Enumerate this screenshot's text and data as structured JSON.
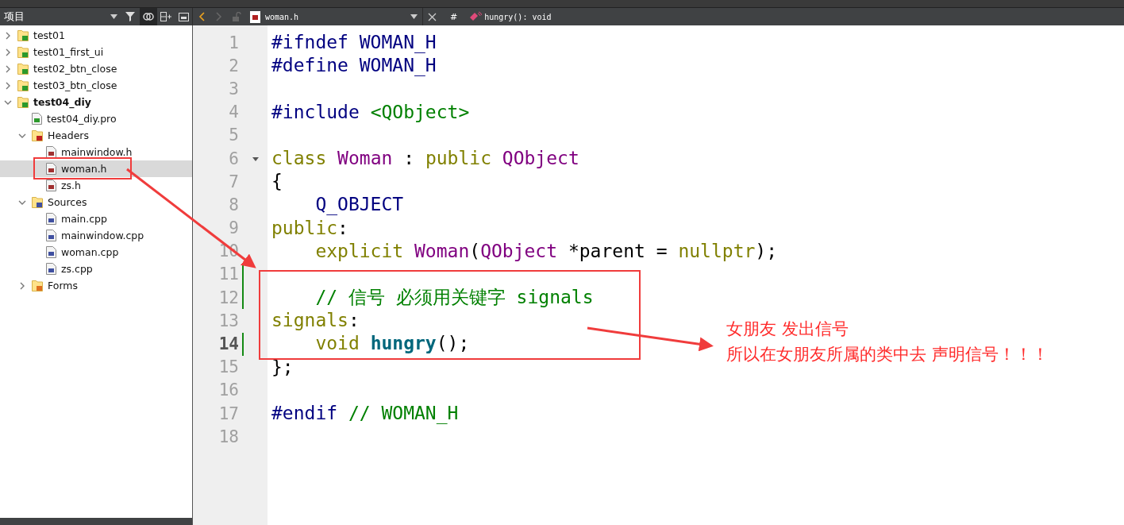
{
  "toolbar": {
    "panel_title": "项目",
    "file": "woman.h",
    "hash": "#",
    "symbol": "hungry(): void"
  },
  "tree": [
    {
      "label": "test01",
      "kind": "project",
      "active": false,
      "expanded": false,
      "selected": false
    },
    {
      "label": "test01_first_ui",
      "kind": "project",
      "active": false,
      "expanded": false,
      "selected": false
    },
    {
      "label": "test02_btn_close",
      "kind": "project",
      "active": false,
      "expanded": false,
      "selected": false
    },
    {
      "label": "test03_btn_close",
      "kind": "project",
      "active": false,
      "expanded": false,
      "selected": false
    },
    {
      "label": "test04_diy",
      "kind": "project",
      "active": true,
      "expanded": true,
      "selected": false,
      "children": [
        {
          "label": "test04_diy.pro",
          "kind": "pro",
          "selected": false
        },
        {
          "label": "Headers",
          "kind": "headers",
          "expanded": true,
          "selected": false,
          "children": [
            {
              "label": "mainwindow.h",
              "kind": "header",
              "selected": false
            },
            {
              "label": "woman.h",
              "kind": "header",
              "selected": true
            },
            {
              "label": "zs.h",
              "kind": "header",
              "selected": false
            }
          ]
        },
        {
          "label": "Sources",
          "kind": "sources",
          "expanded": true,
          "selected": false,
          "children": [
            {
              "label": "main.cpp",
              "kind": "source",
              "selected": false
            },
            {
              "label": "mainwindow.cpp",
              "kind": "source",
              "selected": false
            },
            {
              "label": "woman.cpp",
              "kind": "source",
              "selected": false
            },
            {
              "label": "zs.cpp",
              "kind": "source",
              "selected": false
            }
          ]
        },
        {
          "label": "Forms",
          "kind": "forms",
          "expanded": false,
          "selected": false
        }
      ]
    }
  ],
  "code": [
    {
      "number": "1",
      "current": false,
      "changed": false,
      "fold": false,
      "tokens": [
        {
          "text": "#ifndef WOMAN_H",
          "kind": "preprocessor"
        }
      ]
    },
    {
      "number": "2",
      "current": false,
      "changed": false,
      "fold": false,
      "tokens": [
        {
          "text": "#define WOMAN_H",
          "kind": "preprocessor"
        }
      ]
    },
    {
      "number": "3",
      "current": false,
      "changed": false,
      "fold": false
    },
    {
      "number": "4",
      "current": false,
      "changed": false,
      "fold": false,
      "tokens": [
        {
          "text": "#include ",
          "kind": "preprocessor"
        },
        {
          "text": "<QObject>",
          "kind": "string"
        }
      ]
    },
    {
      "number": "5",
      "current": false,
      "changed": false,
      "fold": false
    },
    {
      "number": "6",
      "current": false,
      "changed": false,
      "fold": true,
      "tokens": [
        {
          "text": "class ",
          "kind": "keyword"
        },
        {
          "text": "Woman",
          "kind": "type"
        },
        {
          "text": " : ",
          "kind": "plain"
        },
        {
          "text": "public ",
          "kind": "keyword"
        },
        {
          "text": "QObject",
          "kind": "type"
        }
      ]
    },
    {
      "number": "7",
      "current": false,
      "changed": false,
      "fold": false,
      "tokens": [
        {
          "text": "{",
          "kind": "plain"
        }
      ]
    },
    {
      "number": "8",
      "current": false,
      "changed": false,
      "fold": false,
      "tokens": [
        {
          "text": "    Q_OBJECT",
          "kind": "preprocessor"
        }
      ]
    },
    {
      "number": "9",
      "current": false,
      "changed": false,
      "fold": false,
      "tokens": [
        {
          "text": "public",
          "kind": "keyword"
        },
        {
          "text": ":",
          "kind": "plain"
        }
      ]
    },
    {
      "number": "10",
      "current": false,
      "changed": false,
      "fold": false,
      "tokens": [
        {
          "text": "    explicit ",
          "kind": "keyword"
        },
        {
          "text": "Woman",
          "kind": "type"
        },
        {
          "text": "(",
          "kind": "plain"
        },
        {
          "text": "QObject",
          "kind": "type"
        },
        {
          "text": " *parent = ",
          "kind": "plain"
        },
        {
          "text": "nullptr",
          "kind": "keyword"
        },
        {
          "text": ");",
          "kind": "plain"
        }
      ]
    },
    {
      "number": "11",
      "current": false,
      "changed": true,
      "fold": false
    },
    {
      "number": "12",
      "current": false,
      "changed": true,
      "fold": false,
      "tokens": [
        {
          "text": "    // 信号 必须用关键字 signals",
          "kind": "comment"
        }
      ]
    },
    {
      "number": "13",
      "current": false,
      "changed": false,
      "fold": false,
      "tokens": [
        {
          "text": "signals",
          "kind": "keyword"
        },
        {
          "text": ":",
          "kind": "plain"
        }
      ]
    },
    {
      "number": "14",
      "current": true,
      "changed": true,
      "fold": false,
      "tokens": [
        {
          "text": "    void ",
          "kind": "keyword"
        },
        {
          "text": "hungry",
          "kind": "function"
        },
        {
          "text": "();",
          "kind": "plain"
        }
      ]
    },
    {
      "number": "15",
      "current": false,
      "changed": false,
      "fold": false,
      "tokens": [
        {
          "text": "};",
          "kind": "plain"
        }
      ]
    },
    {
      "number": "16",
      "current": false,
      "changed": false,
      "fold": false
    },
    {
      "number": "17",
      "current": false,
      "changed": false,
      "fold": false,
      "tokens": [
        {
          "text": "#endif",
          "kind": "preprocessor"
        },
        {
          "text": " // WOMAN_H",
          "kind": "comment"
        }
      ]
    },
    {
      "number": "18",
      "current": false,
      "changed": false,
      "fold": false
    }
  ],
  "annotation": {
    "lines": [
      "女朋友 发出信号",
      "所以在女朋友所属的类中去 声明信号！！！"
    ]
  }
}
